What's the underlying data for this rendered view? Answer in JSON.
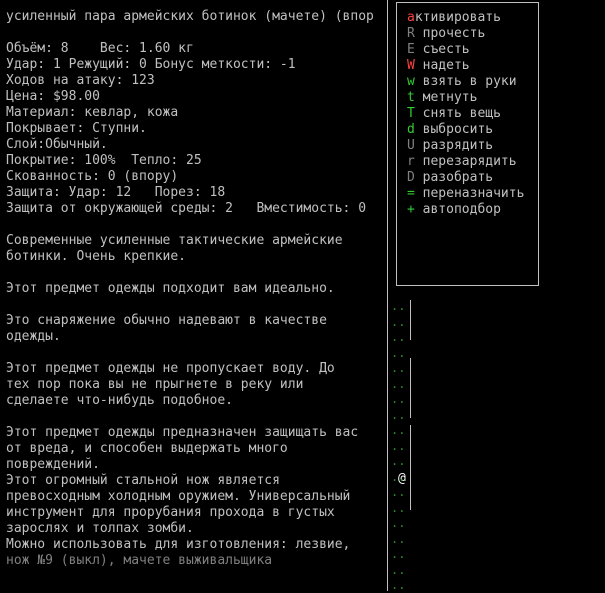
{
  "item": {
    "title": "усиленный пара армейских ботинок (мачете) (впор",
    "lines": [
      "Объём: 8    Вес: 1.60 кг",
      "Удар: 1 Режущий: 0 Бонус меткости: -1",
      "Ходов на атаку: 123",
      "Цена: $98.00",
      "Материал: кевлар, кожа",
      "Покрывает: Ступни.",
      "Слой:Обычный.",
      "Покрытие: 100%  Тепло: 25",
      "Скованность: 0 (впору)",
      "Защита: Удар: 12   Порез: 18",
      "Защита от окружающей среды: 2   Вместимость: 0",
      "",
      "Современные усиленные тактические армейские",
      "ботинки. Очень крепкие.",
      "",
      "Этот предмет одежды подходит вам идеально.",
      "",
      "Это снаряжение обычно надевают в качестве",
      "одежды.",
      "",
      "Этот предмет одежды не пропускает воду. До",
      "тех пор пока вы не прыгнете в реку или",
      "сделаете что-нибудь подобное.",
      "",
      "Этот предмет одежды предназначен защищать вас",
      "от вреда, и способен выдержать много",
      "повреждений.",
      "Этот огромный стальной нож является",
      "превосходным холодным оружием. Универсальный",
      "инструмент для прорубания прохода в густых",
      "зарослях и толпах зомби.",
      "Можно использовать для изготовления: лезвие,"
    ],
    "last_line": "нож №9 (выкл), мачете выживальщика"
  },
  "menu": [
    {
      "key": "a",
      "label": "ктивировать",
      "color": "#ff4040"
    },
    {
      "key": "R",
      "label": " прочесть",
      "color": "#808080"
    },
    {
      "key": "E",
      "label": " съесть",
      "color": "#808080"
    },
    {
      "key": "W",
      "label": " надеть",
      "color": "#ff4040"
    },
    {
      "key": "w",
      "label": " взять в руки",
      "color": "#33cc33"
    },
    {
      "key": "t",
      "label": " метнуть",
      "color": "#33cc33"
    },
    {
      "key": "T",
      "label": " снять вещь",
      "color": "#33cc33"
    },
    {
      "key": "d",
      "label": " выбросить",
      "color": "#33cc33"
    },
    {
      "key": "U",
      "label": " разрядить",
      "color": "#808080"
    },
    {
      "key": "r",
      "label": " перезарядить",
      "color": "#808080"
    },
    {
      "key": "D",
      "label": " разобрать",
      "color": "#808080"
    },
    {
      "key": "=",
      "label": " переназначить",
      "color": "#33cc33"
    },
    {
      "key": "+",
      "label": " автоподбор",
      "color": "#33cc33"
    }
  ],
  "map": {
    "dot_rows": [
      "..",
      "..",
      "..",
      "..",
      "..",
      "..",
      "..",
      "..",
      "..",
      "..",
      "..",
      "..",
      "..",
      "..",
      "..",
      "..",
      "..",
      "..",
      ".."
    ],
    "player_glyph": "@"
  }
}
